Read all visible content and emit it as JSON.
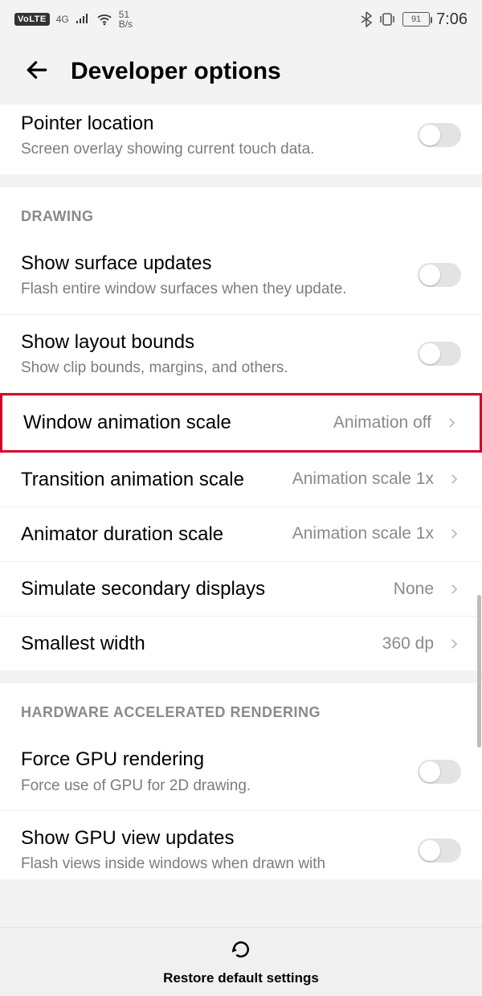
{
  "statusbar": {
    "volte": "VoLTE",
    "net": "4G",
    "speed_top": "51",
    "speed_bottom": "B/s",
    "battery": "91",
    "time": "7:06"
  },
  "header": {
    "title": "Developer options"
  },
  "partial_top": {
    "title": "Pointer location",
    "sub": "Screen overlay showing current touch data."
  },
  "drawing": {
    "header": "DRAWING",
    "surface_updates": {
      "title": "Show surface updates",
      "sub": "Flash entire window surfaces when they update."
    },
    "layout_bounds": {
      "title": "Show layout bounds",
      "sub": "Show clip bounds, margins, and others."
    },
    "window_anim": {
      "title": "Window animation scale",
      "value": "Animation off"
    },
    "transition_anim": {
      "title": "Transition animation scale",
      "value": "Animation scale 1x"
    },
    "animator_dur": {
      "title": "Animator duration scale",
      "value": "Animation scale 1x"
    },
    "sim_secondary": {
      "title": "Simulate secondary displays",
      "value": "None"
    },
    "smallest_width": {
      "title": "Smallest width",
      "value": "360 dp"
    }
  },
  "hw": {
    "header": "HARDWARE ACCELERATED RENDERING",
    "force_gpu": {
      "title": "Force GPU rendering",
      "sub": "Force use of GPU for 2D drawing."
    },
    "gpu_view": {
      "title": "Show GPU view updates",
      "sub": "Flash views inside windows when drawn with"
    }
  },
  "bottom": {
    "restore": "Restore default settings"
  }
}
